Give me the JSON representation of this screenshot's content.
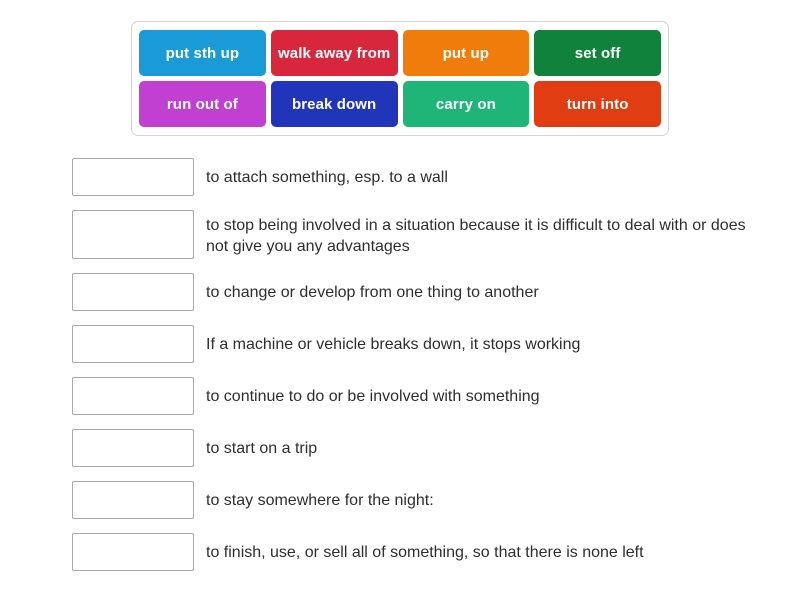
{
  "word_bank": {
    "rows": [
      [
        {
          "label": "put sth up",
          "color": "#1a9bd8"
        },
        {
          "label": "walk away from",
          "color": "#d8273c"
        },
        {
          "label": "put up",
          "color": "#f07c0c"
        },
        {
          "label": "set off",
          "color": "#11823c"
        }
      ],
      [
        {
          "label": "run out of",
          "color": "#c140d2"
        },
        {
          "label": "break down",
          "color": "#2135bb"
        },
        {
          "label": "carry on",
          "color": "#1fb578"
        },
        {
          "label": "turn into",
          "color": "#e03e12"
        }
      ]
    ]
  },
  "definitions": [
    {
      "answer": "",
      "text": "to attach something, esp. to a wall",
      "lines": 1
    },
    {
      "answer": "",
      "text": "to stop being involved in a situation because it is difficult to deal with or does not give you any advantages",
      "lines": 2
    },
    {
      "answer": "",
      "text": "to change or develop from one thing to another",
      "lines": 1
    },
    {
      "answer": "",
      "text": "If a machine or vehicle breaks down, it stops working",
      "lines": 1
    },
    {
      "answer": "",
      "text": "to continue to do or be involved with something",
      "lines": 1
    },
    {
      "answer": "",
      "text": "to start on a trip",
      "lines": 1
    },
    {
      "answer": "",
      "text": "to stay somewhere for the night:",
      "lines": 1
    },
    {
      "answer": "",
      "text": "to finish, use, or sell all of something, so that there is none left",
      "lines": 1
    }
  ],
  "colors": {
    "page_background": "#ffffff",
    "bank_border": "#d5d5d5",
    "drop_box_border": "#a8a8a8",
    "definition_text": "#2e2e2e",
    "tile_text": "#ffffff"
  }
}
